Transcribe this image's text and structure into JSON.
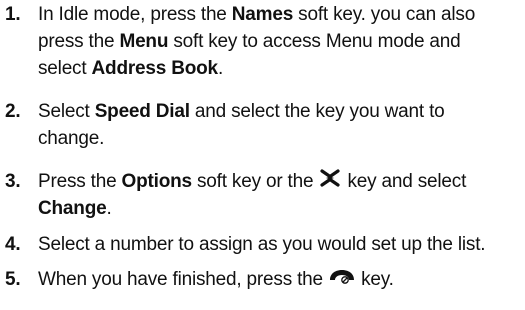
{
  "steps": [
    {
      "number": "1.",
      "lines": [
        [
          "In Idle mode, press the ",
          "Names",
          " soft key. you can also"
        ],
        [
          "press the ",
          "Menu",
          " soft key to access Menu mode and"
        ],
        [
          "select ",
          "Address Book",
          "."
        ]
      ]
    },
    {
      "number": "2.",
      "lines": [
        [
          "Select ",
          "Speed Dial",
          " and select the key you want to"
        ],
        [
          "change."
        ]
      ]
    },
    {
      "number": "3.",
      "lines": [
        [
          "Press the ",
          "Options",
          " soft key or the ",
          "",
          " key and select"
        ],
        [
          "Change",
          "."
        ]
      ],
      "icon": "nav-cross-key-icon"
    },
    {
      "number": "4.",
      "lines": [
        [
          "Select a number to assign as you would set up the list."
        ]
      ]
    },
    {
      "number": "5.",
      "lines": [
        [
          "When you have finished, press the ",
          " key."
        ]
      ],
      "icon": "end-call-key-icon"
    }
  ]
}
